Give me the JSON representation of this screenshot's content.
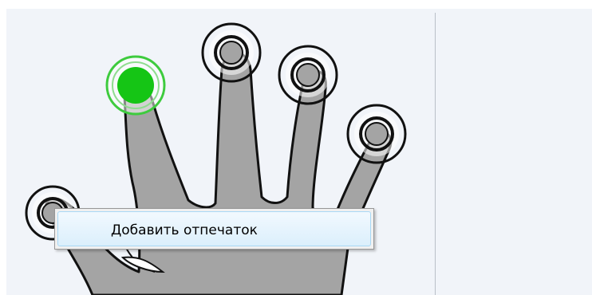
{
  "context_menu": {
    "items": [
      {
        "label": "Добавить отпечаток"
      }
    ]
  },
  "fingers": [
    {
      "name": "thumb",
      "state": "unregistered"
    },
    {
      "name": "index",
      "state": "selected"
    },
    {
      "name": "middle",
      "state": "unregistered"
    },
    {
      "name": "ring",
      "state": "unregistered"
    },
    {
      "name": "little",
      "state": "unregistered"
    }
  ],
  "colors": {
    "selected_dot": "#15c515",
    "selected_ring": "#3ecb3e",
    "hand_fill": "#a4a4a4",
    "hand_outline": "#111111",
    "panel_bg": "#f1f4f9"
  }
}
